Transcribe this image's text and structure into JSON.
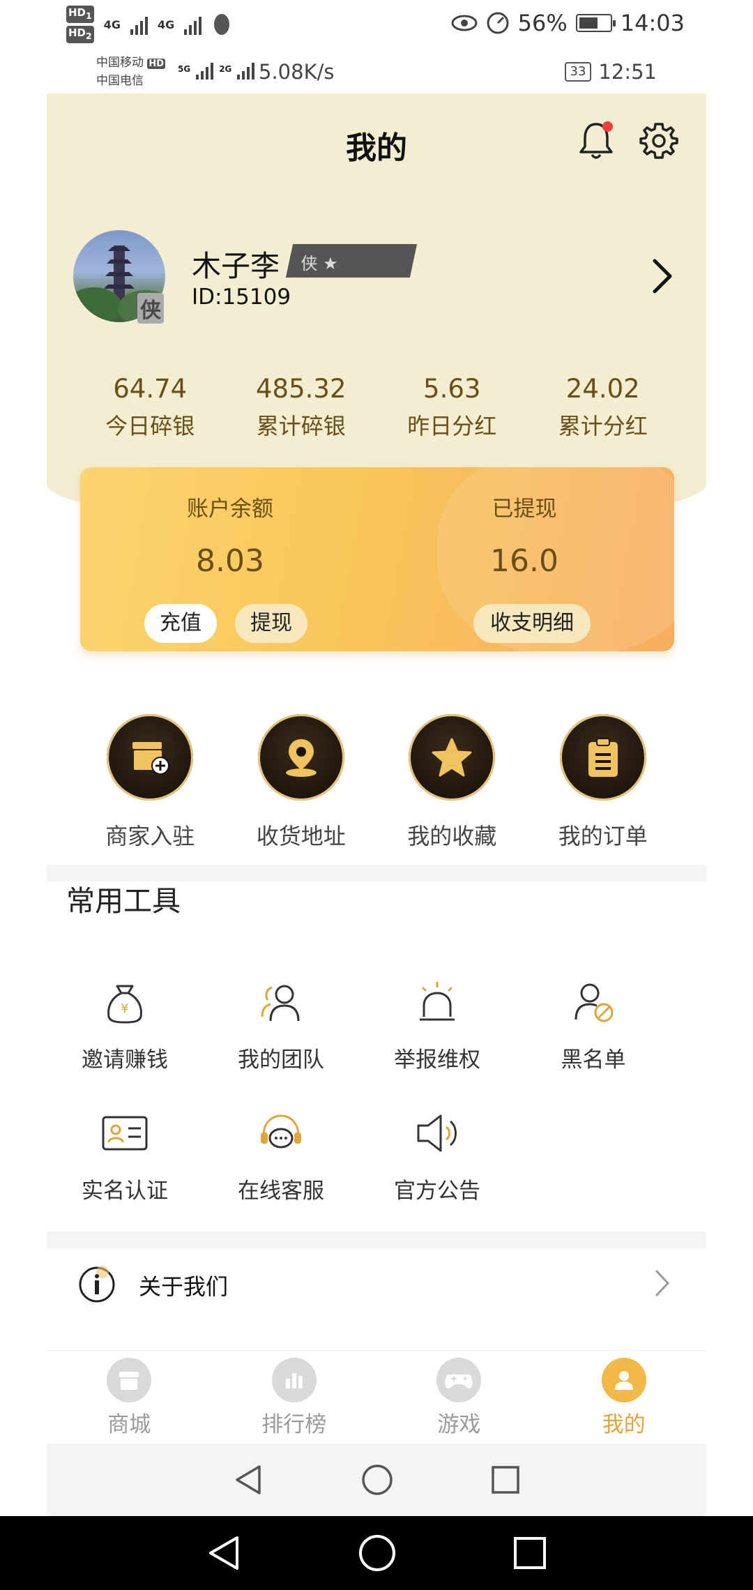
{
  "outer_status": {
    "hd1": "HD",
    "hd1_sub": "1",
    "hd2": "HD",
    "hd2_sub": "2",
    "net1": "4G",
    "net2": "4G",
    "battery_pct": "56%",
    "time": "14:03"
  },
  "inner_status": {
    "carrier1": "中国移动",
    "carrier1_badge": "HD",
    "carrier2": "中国电信",
    "net1": "5G",
    "net2": "2G",
    "speed": "5.08K/s",
    "battery": "33",
    "time": "12:51"
  },
  "header": {
    "title": "我的"
  },
  "profile": {
    "name": "木子李",
    "tag": "侠 ★",
    "avatar_badge": "侠",
    "id": "ID:15109"
  },
  "stats": [
    {
      "value": "64.74",
      "label": "今日碎银"
    },
    {
      "value": "485.32",
      "label": "累计碎银"
    },
    {
      "value": "5.63",
      "label": "昨日分红"
    },
    {
      "value": "24.02",
      "label": "累计分红"
    }
  ],
  "wallet": {
    "balance_label": "账户余额",
    "balance_value": "8.03",
    "withdrawn_label": "已提现",
    "withdrawn_value": "16.0",
    "recharge": "充值",
    "withdraw": "提现",
    "detail": "收支明细"
  },
  "quick_actions": [
    {
      "label": "商家入驻",
      "icon": "store-add-icon"
    },
    {
      "label": "收货地址",
      "icon": "location-pin-icon"
    },
    {
      "label": "我的收藏",
      "icon": "star-icon"
    },
    {
      "label": "我的订单",
      "icon": "clipboard-icon"
    }
  ],
  "tools": {
    "title": "常用工具",
    "items": [
      {
        "label": "邀请赚钱",
        "icon": "money-bag-icon"
      },
      {
        "label": "我的团队",
        "icon": "team-icon"
      },
      {
        "label": "举报维权",
        "icon": "alarm-icon"
      },
      {
        "label": "黑名单",
        "icon": "user-block-icon"
      },
      {
        "label": "实名认证",
        "icon": "id-card-icon"
      },
      {
        "label": "在线客服",
        "icon": "headset-icon"
      },
      {
        "label": "官方公告",
        "icon": "speaker-icon"
      }
    ]
  },
  "menu": {
    "about": "关于我们"
  },
  "tabbar": [
    {
      "label": "商城",
      "icon": "shop-icon"
    },
    {
      "label": "排行榜",
      "icon": "ranking-icon"
    },
    {
      "label": "游戏",
      "icon": "gamepad-icon"
    },
    {
      "label": "我的",
      "icon": "user-icon",
      "active": true
    }
  ],
  "colors": {
    "accent": "#f3b948",
    "header_bg": "#f3eed2",
    "brown_text": "#6b4e17"
  }
}
